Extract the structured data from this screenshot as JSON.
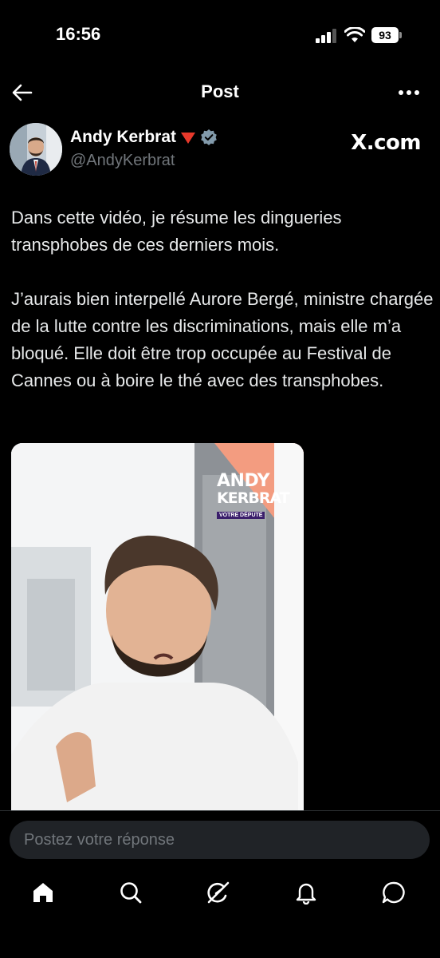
{
  "status_bar": {
    "time": "16:56",
    "battery": "93"
  },
  "header": {
    "title": "Post",
    "back_icon": "arrow-left-icon",
    "more_icon": "more-horizontal-icon"
  },
  "author": {
    "name": "Andy Kerbrat",
    "handle": "@AndyKerbrat",
    "badge_icon": "red-triangle-icon",
    "verified_icon": "verified-badge-icon",
    "verified_color": "#829aab",
    "watermark": "X.com"
  },
  "tweet": {
    "paragraphs": [
      "Dans cette vidéo, je résume les dingueries transphobes de ces derniers mois.",
      "J’aurais bien interpellé Aurore Bergé, ministre chargée de la lutte contre les discriminations, mais elle m’a bloqué. Elle doit être trop occupée au Festival de Cannes ou à boire le thé avec des transphobes."
    ]
  },
  "media": {
    "watermark_line1": "ANDY",
    "watermark_line2": "KERBRAT",
    "watermark_badge": "VOTRE DÉPUTÉ"
  },
  "reply": {
    "placeholder": "Postez votre réponse"
  },
  "tabbar": {
    "items": [
      {
        "icon": "home-icon"
      },
      {
        "icon": "search-icon"
      },
      {
        "icon": "grok-icon"
      },
      {
        "icon": "notifications-bell-icon"
      },
      {
        "icon": "messages-icon"
      }
    ]
  },
  "colors": {
    "background": "#000000",
    "text": "#e7e9ea",
    "secondary_text": "#71767b",
    "input_bg": "#202327",
    "accent_red": "#e8392b"
  }
}
